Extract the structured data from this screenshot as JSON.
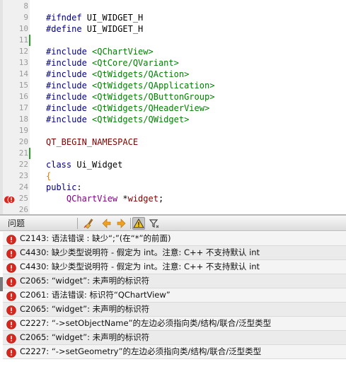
{
  "editor": {
    "lines": [
      {
        "num": "8",
        "parts": []
      },
      {
        "num": "9",
        "parts": [
          {
            "t": "#ifndef",
            "c": "kw"
          },
          {
            "t": " UI_WIDGET_H",
            "c": "tx"
          }
        ]
      },
      {
        "num": "10",
        "parts": [
          {
            "t": "#define",
            "c": "kw"
          },
          {
            "t": " UI_WIDGET_H",
            "c": "tx"
          }
        ]
      },
      {
        "num": "11",
        "parts": [],
        "changed": true
      },
      {
        "num": "12",
        "parts": [
          {
            "t": "#include",
            "c": "kw"
          },
          {
            "t": " <QChartView>",
            "c": "inc"
          }
        ]
      },
      {
        "num": "13",
        "parts": [
          {
            "t": "#include",
            "c": "kw"
          },
          {
            "t": " <QtCore/QVariant>",
            "c": "inc"
          }
        ]
      },
      {
        "num": "14",
        "parts": [
          {
            "t": "#include",
            "c": "kw"
          },
          {
            "t": " <QtWidgets/QAction>",
            "c": "inc"
          }
        ]
      },
      {
        "num": "15",
        "parts": [
          {
            "t": "#include",
            "c": "kw"
          },
          {
            "t": " <QtWidgets/QApplication>",
            "c": "inc"
          }
        ]
      },
      {
        "num": "16",
        "parts": [
          {
            "t": "#include",
            "c": "kw"
          },
          {
            "t": " <QtWidgets/QButtonGroup>",
            "c": "inc"
          }
        ]
      },
      {
        "num": "17",
        "parts": [
          {
            "t": "#include",
            "c": "kw"
          },
          {
            "t": " <QtWidgets/QHeaderView>",
            "c": "inc"
          }
        ]
      },
      {
        "num": "18",
        "parts": [
          {
            "t": "#include",
            "c": "kw"
          },
          {
            "t": " <QtWidgets/QWidget>",
            "c": "inc"
          }
        ]
      },
      {
        "num": "19",
        "parts": []
      },
      {
        "num": "20",
        "parts": [
          {
            "t": "QT_BEGIN_NAMESPACE",
            "c": "mac"
          }
        ]
      },
      {
        "num": "21",
        "parts": [],
        "changed": true
      },
      {
        "num": "22",
        "parts": [
          {
            "t": "class",
            "c": "kw"
          },
          {
            "t": " Ui_Widget",
            "c": "tx"
          }
        ]
      },
      {
        "num": "23",
        "parts": [
          {
            "t": "{",
            "c": "brc"
          }
        ]
      },
      {
        "num": "24",
        "parts": [
          {
            "t": "public",
            "c": "kw"
          },
          {
            "t": ":",
            "c": "tx"
          }
        ]
      },
      {
        "num": "25",
        "parts": [
          {
            "t": "    QChartView",
            "c": "typ"
          },
          {
            "t": " *",
            "c": "tx"
          },
          {
            "t": "widget",
            "c": "var"
          },
          {
            "t": ";",
            "c": "tx"
          }
        ],
        "error": true
      },
      {
        "num": "26",
        "parts": []
      }
    ]
  },
  "issues_panel": {
    "title": "问题",
    "toolbar": {
      "clear_icon": "clean-brush-icon",
      "prev_icon": "arrow-left-icon",
      "next_icon": "arrow-right-icon",
      "warnings_filter_icon": "warning-triangle-icon",
      "filter_icon": "filter-icon"
    },
    "issues": [
      {
        "type": "error",
        "text": "C2143: 语法错误 : 缺少“;”(在“*”的前面)"
      },
      {
        "type": "error",
        "text": "C4430: 缺少类型说明符 - 假定为 int。注意: C++ 不支持默认 int"
      },
      {
        "type": "error",
        "text": "C4430: 缺少类型说明符 - 假定为 int。注意: C++ 不支持默认 int"
      },
      {
        "type": "error",
        "text": "C2065: “widget”: 未声明的标识符"
      },
      {
        "type": "error",
        "text": "C2061: 语法错误: 标识符“QChartView”"
      },
      {
        "type": "error",
        "text": "C2065: “widget”: 未声明的标识符"
      },
      {
        "type": "error",
        "text": "C2227: “->setObjectName”的左边必须指向类/结构/联合/泛型类型"
      },
      {
        "type": "error",
        "text": "C2065: “widget”: 未声明的标识符"
      },
      {
        "type": "error",
        "text": "C2227: “->setGeometry”的左边必须指向类/结构/联合/泛型类型"
      }
    ]
  },
  "colors": {
    "error_red": "#d9261c",
    "change_green": "#2e9a2e",
    "keyword": "#000080",
    "include": "#008000"
  }
}
